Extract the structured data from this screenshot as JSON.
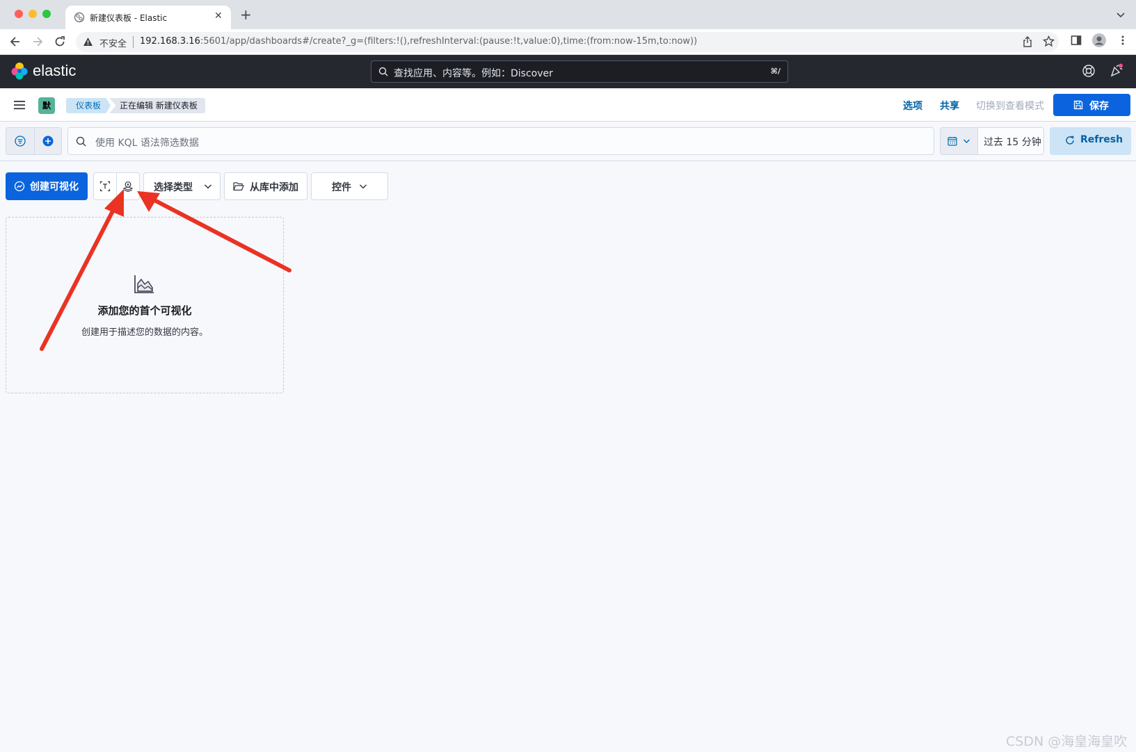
{
  "browser": {
    "tab_title": "新建仪表板 - Elastic",
    "security_label": "不安全",
    "url_host": "192.168.3.16",
    "url_rest": ":5601/app/dashboards#/create?_g=(filters:!(),refreshInterval:(pause:!t,value:0),time:(from:now-15m,to:now))"
  },
  "header": {
    "brand": "elastic",
    "search_placeholder": "查找应用、内容等。例如：Discover",
    "search_shortcut": "⌘/"
  },
  "subheader": {
    "space_initial": "默",
    "breadcrumbs": [
      "仪表板",
      "正在编辑 新建仪表板"
    ],
    "options_label": "选项",
    "share_label": "共享",
    "view_mode_label": "切换到查看模式",
    "save_label": "保存"
  },
  "query_bar": {
    "placeholder": "使用 KQL 语法筛选数据",
    "date_range": "过去 15 分钟",
    "refresh_label": "Refresh"
  },
  "toolbar": {
    "create_label": "创建可视化",
    "select_type_label": "选择类型",
    "add_from_library_label": "从库中添加",
    "controls_label": "控件"
  },
  "empty_state": {
    "title": "添加您的首个可视化",
    "description": "创建用于描述您的数据的内容。"
  },
  "watermark": "CSDN @海皇海皇吹",
  "colors": {
    "primary": "#0b64dd",
    "header_bg": "#25282f",
    "annotation_arrow": "#ea3323"
  }
}
